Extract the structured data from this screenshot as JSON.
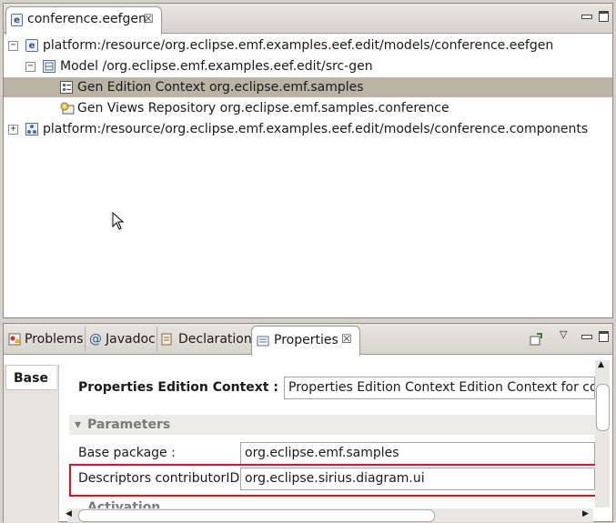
{
  "editor": {
    "tab_label": "conference.eefgen",
    "tab_icon": "e",
    "tree": [
      {
        "label": "platform:/resource/org.eclipse.emf.examples.eef.edit/models/conference.eefgen",
        "expander": "−",
        "icon": "e"
      },
      {
        "label": "Model /org.eclipse.emf.examples.eef.edit/src-gen",
        "expander": "−",
        "icon": "model"
      },
      {
        "label": "Gen Edition Context org.eclipse.emf.samples",
        "expander": "",
        "icon": "context"
      },
      {
        "label": "Gen Views Repository org.eclipse.emf.samples.conference",
        "expander": "",
        "icon": "repo"
      },
      {
        "label": "platform:/resource/org.eclipse.emf.examples.eef.edit/models/conference.components",
        "expander": "+",
        "icon": "components"
      }
    ]
  },
  "views": {
    "tabs": [
      {
        "label": "Problems",
        "icon": "problems-icon"
      },
      {
        "label": "Javadoc",
        "icon": "@"
      },
      {
        "label": "Declaration",
        "icon": "declaration-icon"
      },
      {
        "label": "Properties",
        "icon": "properties-icon"
      }
    ]
  },
  "properties": {
    "side_tab": "Base",
    "context_label": "Properties Edition Context :",
    "context_value": "Properties Edition Context Edition Context for conference",
    "section_title": "Parameters",
    "section_arrow": "▾",
    "base_package_label": "Base package :",
    "base_package_value": "org.eclipse.emf.samples",
    "contributor_label": "Descriptors contributorID :",
    "contributor_value": "org.eclipse.sirius.diagram.ui",
    "next_section_partial": "Activation",
    "highlight_color": "#e0101e",
    "selection_color": "#bbb3a4"
  }
}
